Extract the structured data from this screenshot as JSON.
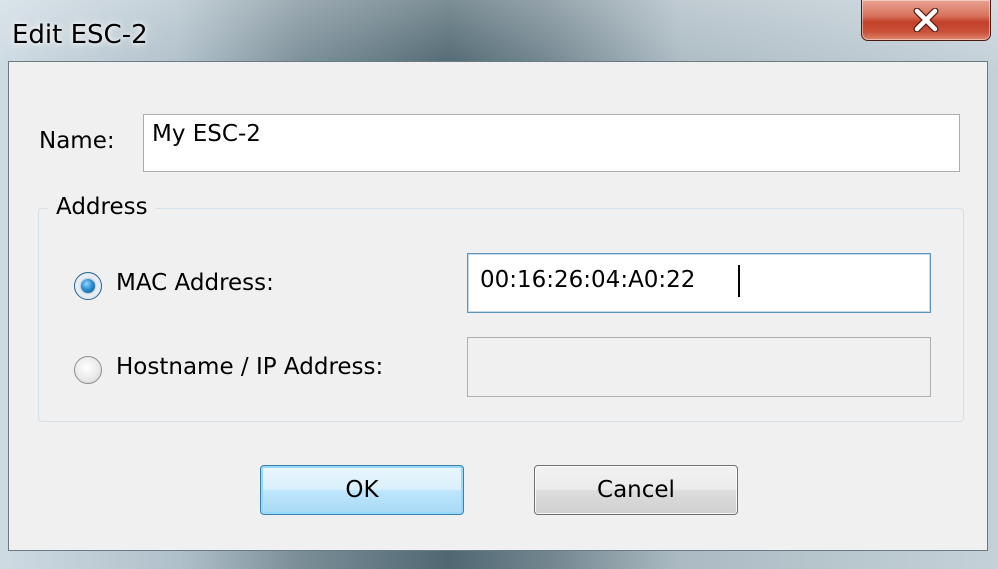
{
  "window": {
    "title": "Edit ESC-2"
  },
  "form": {
    "name_label": "Name:",
    "name_value": "My ESC-2",
    "address_group_label": "Address",
    "mac": {
      "label": "MAC Address:",
      "value": "00:16:26:04:A0:22",
      "selected": true
    },
    "hostname": {
      "label": "Hostname / IP Address:",
      "value": "",
      "selected": false
    }
  },
  "buttons": {
    "ok_label": "OK",
    "cancel_label": "Cancel"
  },
  "icons": {
    "close": "close-icon",
    "radio_checked": "radio-checked-icon",
    "radio_unchecked": "radio-unchecked-icon"
  },
  "colors": {
    "close_button": "#c3412a",
    "default_button_border": "#3c7fb1",
    "radio_dot": "#2f8fd1"
  }
}
